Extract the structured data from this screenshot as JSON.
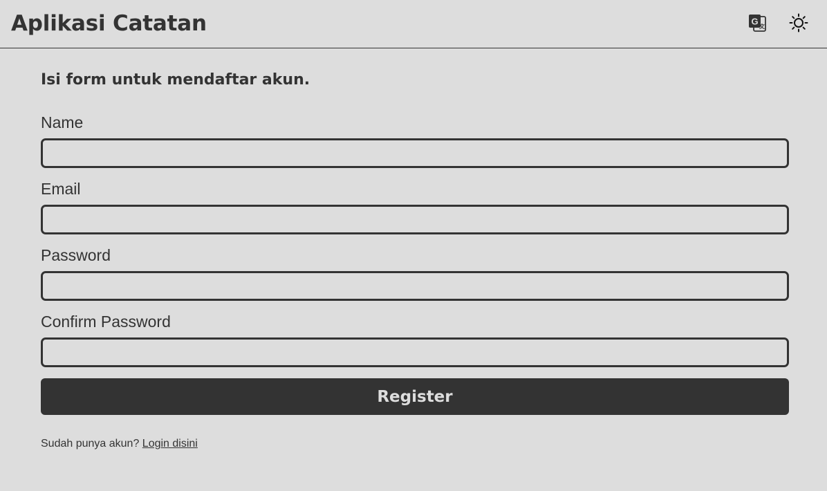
{
  "header": {
    "title": "Aplikasi Catatan",
    "translate_icon": "translate-icon",
    "theme_icon": "sun-icon"
  },
  "register": {
    "intro": "Isi form untuk mendaftar akun.",
    "fields": [
      {
        "label": "Name",
        "value": "",
        "type": "text"
      },
      {
        "label": "Email",
        "value": "",
        "type": "email"
      },
      {
        "label": "Password",
        "value": "",
        "type": "password"
      },
      {
        "label": "Confirm Password",
        "value": "",
        "type": "password"
      }
    ],
    "submit_label": "Register",
    "login_prompt": "Sudah punya akun?",
    "login_link": "Login disini"
  },
  "colors": {
    "background": "#dddddd",
    "foreground": "#333333"
  }
}
